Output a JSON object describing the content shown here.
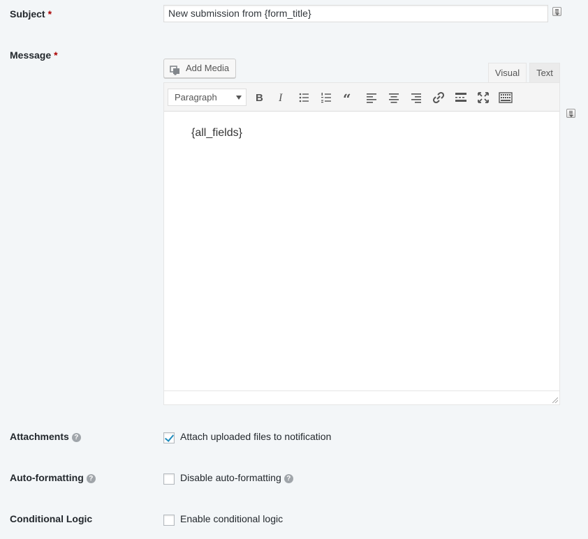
{
  "subject": {
    "label": "Subject",
    "required_mark": "*",
    "value": "New submission from {form_title}",
    "merge_tag_icon": "merge-tags-icon"
  },
  "message": {
    "label": "Message",
    "required_mark": "*",
    "add_media_label": "Add Media",
    "tabs": [
      {
        "label": "Visual",
        "active": true
      },
      {
        "label": "Text",
        "active": false
      }
    ],
    "format_select": "Paragraph",
    "toolbar_icons": [
      "bold-icon",
      "italic-icon",
      "bulleted-list-icon",
      "numbered-list-icon",
      "blockquote-icon",
      "align-left-icon",
      "align-center-icon",
      "align-right-icon",
      "link-icon",
      "read-more-icon",
      "fullscreen-icon",
      "toolbar-toggle-icon"
    ],
    "content": "{all_fields}"
  },
  "attachments": {
    "label": "Attachments",
    "checkbox_label": "Attach uploaded files to notification",
    "checked": true
  },
  "auto_formatting": {
    "label": "Auto-formatting",
    "checkbox_label": "Disable auto-formatting",
    "checked": false
  },
  "conditional_logic": {
    "label": "Conditional Logic",
    "checkbox_label": "Enable conditional logic",
    "checked": false
  },
  "colors": {
    "required": "#aa0000",
    "checkbox_check": "#1e8cbe",
    "background": "#f3f6f8"
  }
}
